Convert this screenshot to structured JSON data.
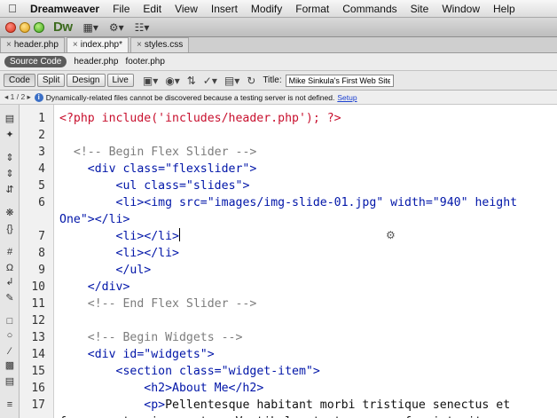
{
  "menubar": {
    "app_name": "Dreamweaver",
    "items": [
      "File",
      "Edit",
      "View",
      "Insert",
      "Modify",
      "Format",
      "Commands",
      "Site",
      "Window",
      "Help"
    ]
  },
  "app_toolbar": {
    "logo": "Dw"
  },
  "document_tabs": [
    {
      "label": "header.php",
      "active": false
    },
    {
      "label": "index.php*",
      "active": true
    },
    {
      "label": "styles.css",
      "active": false
    }
  ],
  "related_files": [
    "Source Code",
    "header.php",
    "footer.php"
  ],
  "doc_toolbar": {
    "views": [
      "Code",
      "Split",
      "Design",
      "Live"
    ],
    "title_label": "Title:",
    "title_value": "Mike Sinkula's First Web Site!"
  },
  "info_bar": {
    "nav": "◂ 1 / 2 ▸",
    "message": "Dynamically-related files cannot be discovered because a testing server is not defined.",
    "link": "Setup"
  },
  "code_lines": [
    {
      "n": "1",
      "indent": 0,
      "text": "<?php include('includes/header.php'); ?>",
      "kind": "php"
    },
    {
      "n": "2",
      "indent": 0,
      "text": "",
      "kind": "txt"
    },
    {
      "n": "3",
      "indent": 1,
      "text": "<!-- Begin Flex Slider -->",
      "kind": "cmt"
    },
    {
      "n": "4",
      "indent": 2,
      "text": "<div class=\"flexslider\">",
      "kind": "tag"
    },
    {
      "n": "5",
      "indent": 4,
      "text": "<ul class=\"slides\">",
      "kind": "tag"
    },
    {
      "n": "6",
      "indent": 4,
      "text": "<li><img src=\"images/img-slide-01.jpg\" width=\"940\" height",
      "kind": "tag"
    },
    {
      "n": "",
      "indent": 0,
      "text": "One\"></li>",
      "kind": "tag"
    },
    {
      "n": "7",
      "indent": 4,
      "text": "<li></li>",
      "kind": "tag"
    },
    {
      "n": "8",
      "indent": 4,
      "text": "<li></li>",
      "kind": "tag"
    },
    {
      "n": "9",
      "indent": 4,
      "text": "</ul>",
      "kind": "tag"
    },
    {
      "n": "10",
      "indent": 2,
      "text": "</div>",
      "kind": "tag"
    },
    {
      "n": "11",
      "indent": 2,
      "text": "<!-- End Flex Slider -->",
      "kind": "cmt"
    },
    {
      "n": "12",
      "indent": 0,
      "text": "",
      "kind": "txt"
    },
    {
      "n": "13",
      "indent": 2,
      "text": "<!-- Begin Widgets -->",
      "kind": "cmt"
    },
    {
      "n": "14",
      "indent": 2,
      "text": "<div id=\"widgets\">",
      "kind": "tag"
    },
    {
      "n": "15",
      "indent": 4,
      "text": "<section class=\"widget-item\">",
      "kind": "tag"
    },
    {
      "n": "16",
      "indent": 6,
      "text": "<h2>About Me</h2>",
      "kind": "tag"
    },
    {
      "n": "17",
      "indent": 6,
      "text": "<p>Pellentesque habitant morbi tristique senectus et",
      "kind": "mixed"
    },
    {
      "n": "",
      "indent": 0,
      "text": "fames ac turpis egestas. Vestibulum tortor quam, feugiat vitae",
      "kind": "txt"
    }
  ]
}
